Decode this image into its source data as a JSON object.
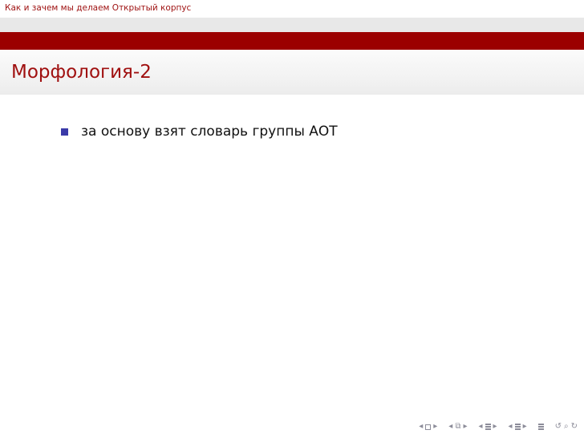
{
  "header": {
    "short_title": "Как и зачем мы делаем Открытый корпус"
  },
  "frame": {
    "title": "Морфология-2",
    "bullets": [
      "за основу взят словарь группы АОТ"
    ]
  },
  "colors": {
    "accent": "#9b0000",
    "title_text": "#a01010",
    "bullet": "#3a3aa8",
    "nav": "#8c8c99"
  },
  "navigation": {
    "icons": [
      "prev-arrow-icon",
      "slide-icon",
      "next-arrow-icon",
      "prev-arrow-icon",
      "frame-icon",
      "next-arrow-icon",
      "prev-arrow-icon",
      "subsection-icon",
      "next-arrow-icon",
      "prev-arrow-icon",
      "section-icon",
      "next-arrow-icon",
      "align-icon",
      "back-icon",
      "search-icon"
    ]
  }
}
